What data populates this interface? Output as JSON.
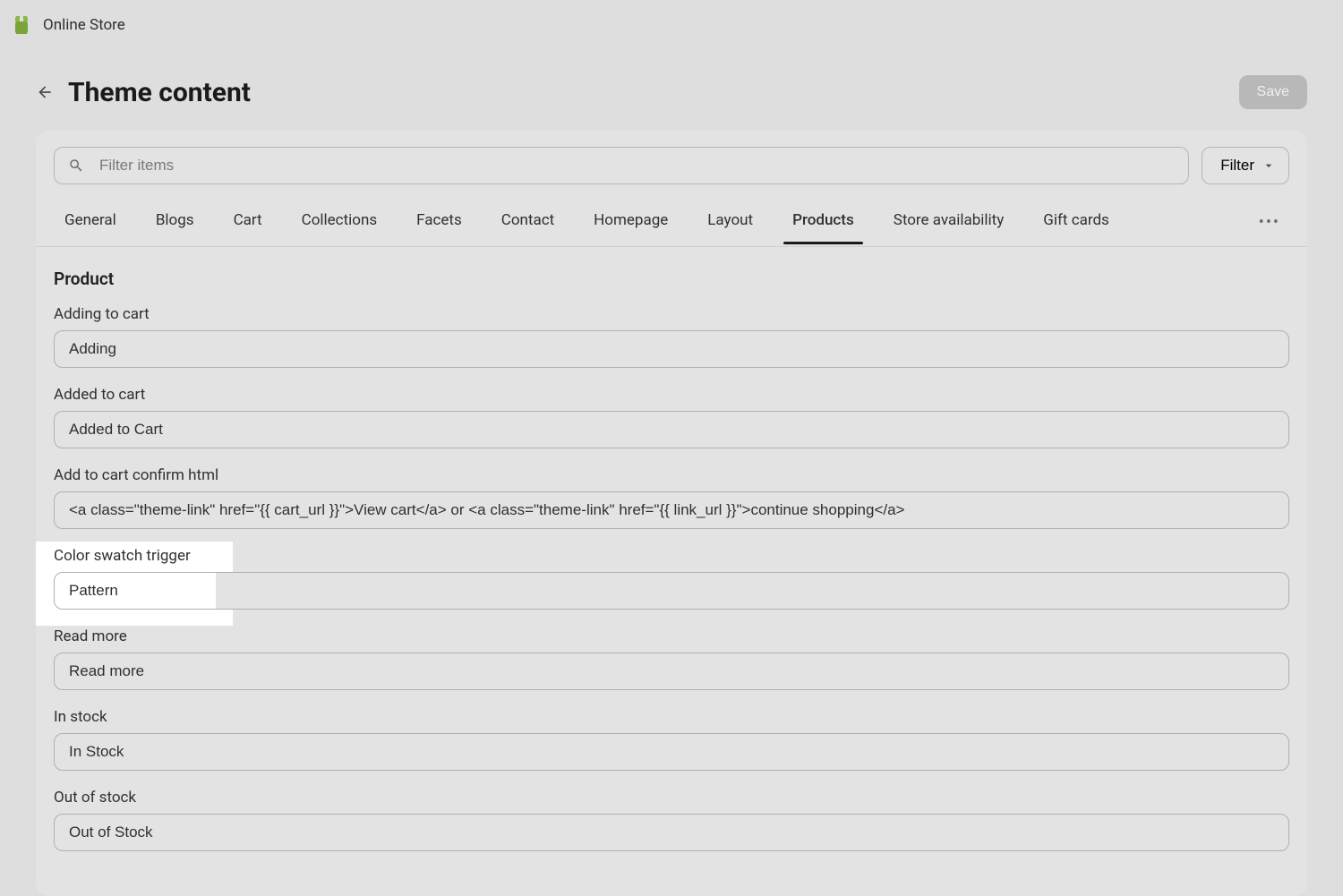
{
  "topbar": {
    "title": "Online Store"
  },
  "header": {
    "title": "Theme content",
    "save_label": "Save"
  },
  "search": {
    "placeholder": "Filter items"
  },
  "filter_button": {
    "label": "Filter"
  },
  "tabs": [
    {
      "label": "General",
      "active": false
    },
    {
      "label": "Blogs",
      "active": false
    },
    {
      "label": "Cart",
      "active": false
    },
    {
      "label": "Collections",
      "active": false
    },
    {
      "label": "Facets",
      "active": false
    },
    {
      "label": "Contact",
      "active": false
    },
    {
      "label": "Homepage",
      "active": false
    },
    {
      "label": "Layout",
      "active": false
    },
    {
      "label": "Products",
      "active": true
    },
    {
      "label": "Store availability",
      "active": false
    },
    {
      "label": "Gift cards",
      "active": false
    }
  ],
  "section": {
    "title": "Product"
  },
  "fields": [
    {
      "label": "Adding to cart",
      "value": "Adding"
    },
    {
      "label": "Added to cart",
      "value": "Added to Cart"
    },
    {
      "label": "Add to cart confirm html",
      "value": "<a class=\"theme-link\" href=\"{{ cart_url }}\">View cart</a> or <a class=\"theme-link\" href=\"{{ link_url }}\">continue shopping</a>"
    },
    {
      "label": "Color swatch trigger",
      "value": "Pattern",
      "highlighted": true
    },
    {
      "label": "Read more",
      "value": "Read more"
    },
    {
      "label": "In stock",
      "value": "In Stock"
    },
    {
      "label": "Out of stock",
      "value": "Out of Stock"
    }
  ]
}
